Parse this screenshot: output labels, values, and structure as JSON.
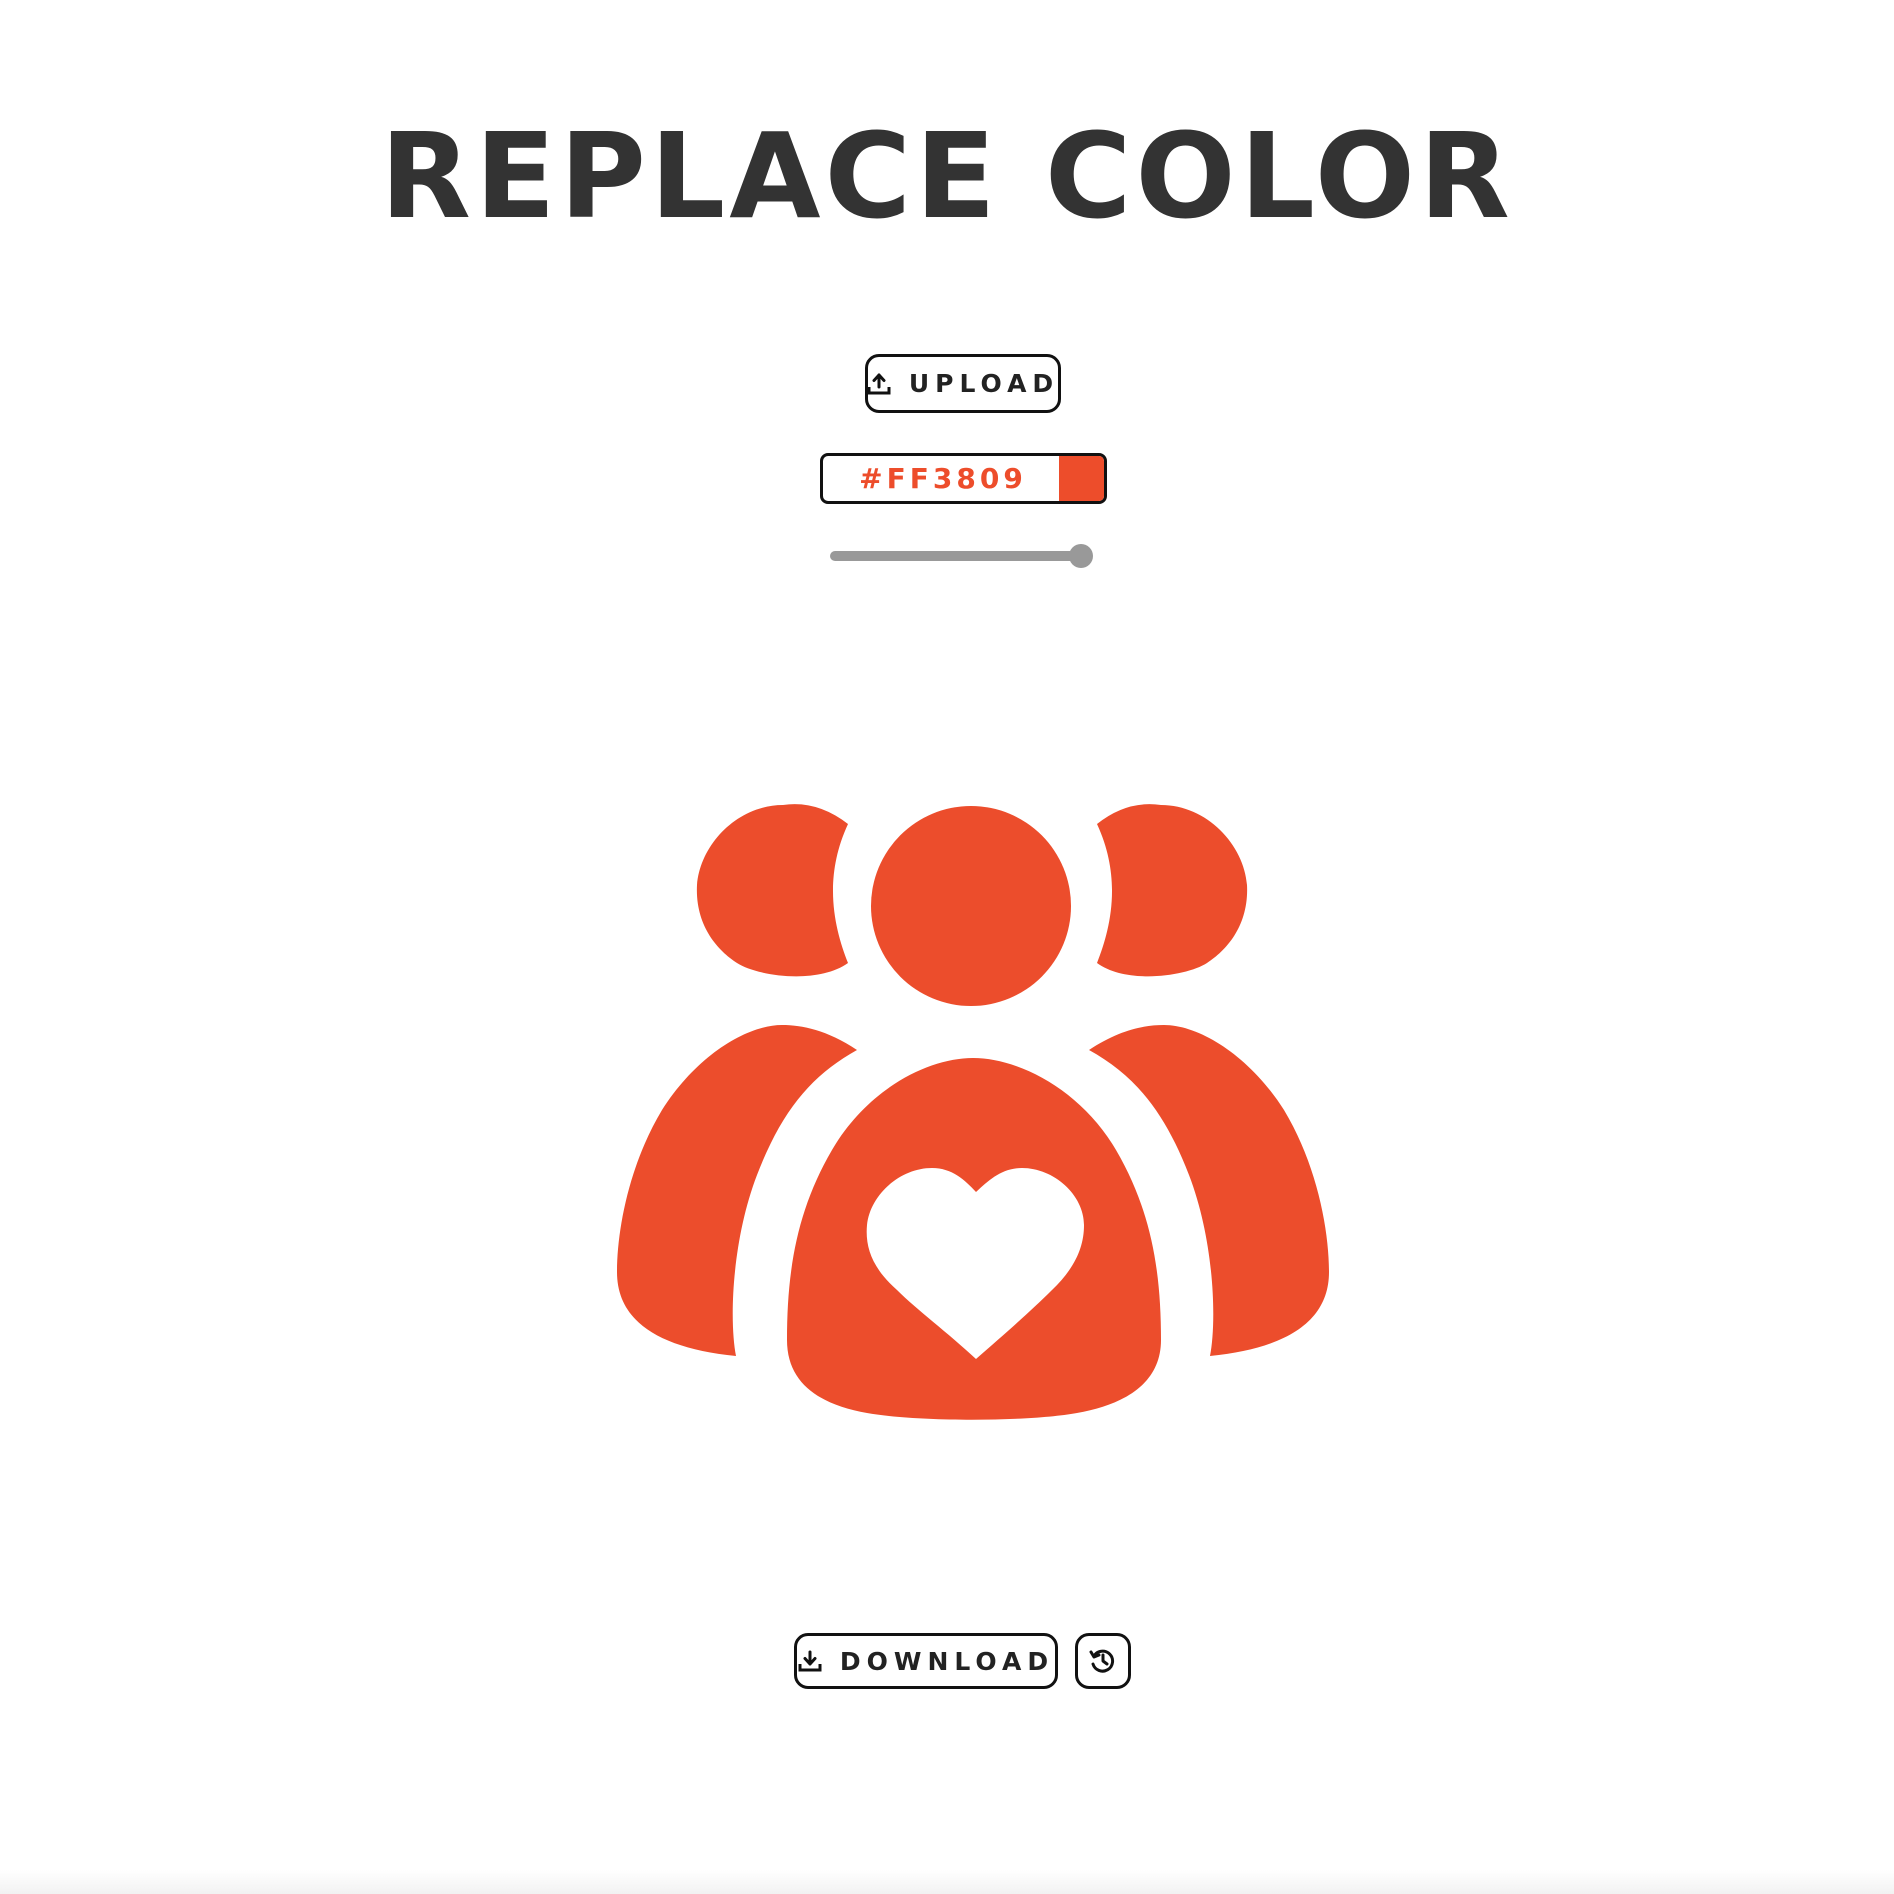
{
  "header": {
    "title": "REPLACE COLOR"
  },
  "toolbar": {
    "upload_label": "UPLOAD",
    "upload_icon": "upload-icon"
  },
  "color_picker": {
    "value": "#FF3809",
    "swatch_color": "#ED4D2B",
    "text_color": "#ED4D2B"
  },
  "tolerance_slider": {
    "value": 100,
    "min": 0,
    "max": 100
  },
  "preview": {
    "icon": "group-heart-icon",
    "fill_color": "#EC4D2C"
  },
  "footer": {
    "download_label": "DOWNLOAD",
    "download_icon": "download-icon",
    "history_icon": "history-icon"
  }
}
